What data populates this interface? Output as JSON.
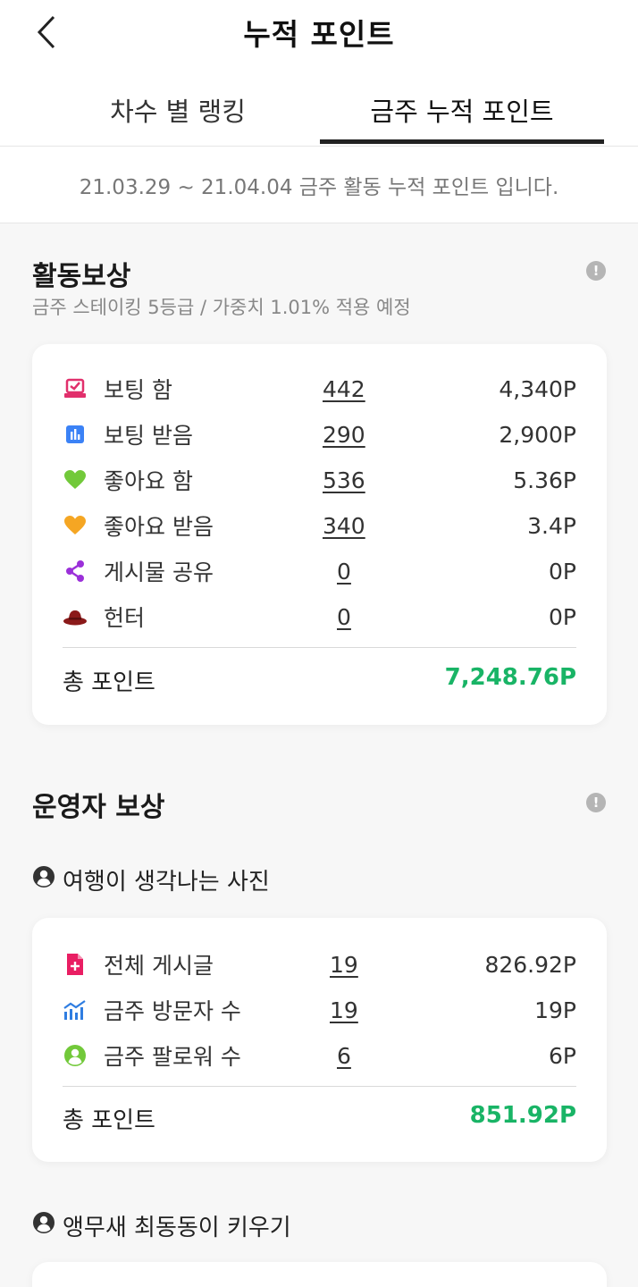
{
  "header": {
    "title": "누적 포인트",
    "back_icon": "chevron-left-icon"
  },
  "tabs": [
    {
      "label": "차수 별 랭킹",
      "active": false
    },
    {
      "label": "금주 누적 포인트",
      "active": true
    }
  ],
  "period_text": "21.03.29 ~ 21.04.04 금주 활동 누적 포인트 입니다.",
  "activity": {
    "title": "활동보상",
    "subtitle": "금주 스테이킹 5등급 / 가중치 1.01% 적용 예정",
    "rows": [
      {
        "icon": "vote-box-icon",
        "label": "보팅 함",
        "count": "442",
        "points": "4,340P"
      },
      {
        "icon": "bar-chart-icon",
        "label": "보팅 받음",
        "count": "290",
        "points": "2,900P"
      },
      {
        "icon": "heart-icon",
        "label": "좋아요 함",
        "count": "536",
        "points": "5.36P"
      },
      {
        "icon": "heart-icon",
        "label": "좋아요 받음",
        "count": "340",
        "points": "3.4P"
      },
      {
        "icon": "share-icon",
        "label": "게시물 공유",
        "count": "0",
        "points": "0P"
      },
      {
        "icon": "hat-icon",
        "label": "헌터",
        "count": "0",
        "points": "0P"
      }
    ],
    "total_label": "총 포인트",
    "total_value": "7,248.76P"
  },
  "operator": {
    "title": "운영자 보상",
    "communities": [
      {
        "name": "여행이 생각나는 사진",
        "rows": [
          {
            "icon": "document-plus-icon",
            "label": "전체 게시글",
            "count": "19",
            "points": "826.92P"
          },
          {
            "icon": "stats-icon",
            "label": "금주 방문자 수",
            "count": "19",
            "points": "19P"
          },
          {
            "icon": "user-circle-icon",
            "label": "금주 팔로워 수",
            "count": "6",
            "points": "6P"
          }
        ],
        "total_label": "총 포인트",
        "total_value": "851.92P"
      },
      {
        "name": "앵무새 최동동이 키우기"
      }
    ]
  },
  "colors": {
    "accent_green": "#19b466",
    "tab_underline": "#222222"
  }
}
